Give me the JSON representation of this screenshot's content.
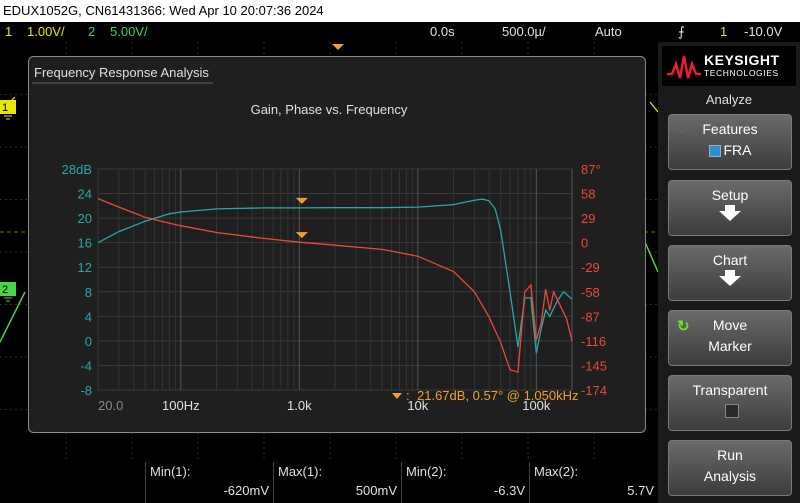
{
  "window": {
    "title": "EDUX1052G, CN61431366: Wed Apr 10 20:07:36 2024"
  },
  "status": {
    "ch1_num": "1",
    "ch1_scale": "1.00V/",
    "ch2_num": "2",
    "ch2_scale": "5.00V/",
    "time_pos": "0.0s",
    "time_scale": "500.0µ/",
    "trigger_mode": "Auto",
    "trig_src": "1",
    "trig_level": "-10.0V"
  },
  "fra": {
    "window_title": "Frequency Response Analysis",
    "plot_title": "Gain, Phase vs. Frequency",
    "marker_readout": "21.67dB, 0.57° @ 1.050kHz"
  },
  "chart_data": {
    "type": "line",
    "title": "Gain, Phase vs. Frequency",
    "x_scale": "log",
    "x_range_hz": [
      20,
      200000
    ],
    "x_tick_labels": [
      "20.0",
      "100Hz",
      "1.0k",
      "10k",
      "100k"
    ],
    "x_tick_values": [
      20,
      100,
      1000,
      10000,
      100000
    ],
    "y_left_range_db": [
      -8,
      28
    ],
    "y_left_tick_labels": [
      "28dB",
      "24",
      "20",
      "16",
      "12",
      "8",
      "4",
      "0",
      "-4",
      "-8"
    ],
    "y_right_range_deg": [
      -174,
      87
    ],
    "y_right_tick_labels": [
      "87°",
      "58",
      "29",
      "0",
      "-29",
      "-58",
      "-87",
      "-116",
      "-145",
      "-174"
    ],
    "grid": true,
    "series": [
      {
        "axis": "left",
        "color": "#2aa8a8",
        "x": [
          20,
          30,
          50,
          80,
          100,
          200,
          500,
          1000,
          2000,
          5000,
          10000,
          20000,
          30000,
          35000,
          40000,
          45000,
          50000,
          60000,
          70000,
          80000,
          90000,
          100000,
          110000,
          120000,
          130000,
          150000,
          170000,
          200000
        ],
        "y": [
          16,
          17.8,
          19.5,
          20.7,
          21,
          21.5,
          21.67,
          21.67,
          21.7,
          21.7,
          21.8,
          22.2,
          22.9,
          23.1,
          22.8,
          21.5,
          18,
          8,
          -1,
          7,
          7,
          -2,
          2,
          5,
          4,
          6.5,
          8,
          6.8
        ]
      },
      {
        "axis": "right",
        "color": "#e84a3c",
        "x": [
          20,
          30,
          50,
          80,
          100,
          200,
          500,
          1000,
          2000,
          5000,
          10000,
          20000,
          30000,
          40000,
          50000,
          60000,
          70000,
          80000,
          90000,
          100000,
          110000,
          120000,
          130000,
          140000,
          160000,
          180000,
          200000
        ],
        "y": [
          52,
          42,
          30,
          23,
          20,
          12,
          5,
          0.57,
          -3,
          -8,
          -16,
          -34,
          -58,
          -88,
          -118,
          -150,
          -153,
          -58,
          -50,
          -115,
          -95,
          -55,
          -80,
          -58,
          -75,
          -90,
          -116
        ]
      }
    ],
    "marker": {
      "x_hz": 1050,
      "gain_db": 21.67,
      "phase_deg": 0.57
    }
  },
  "side": {
    "brand": "KEYSIGHT",
    "brand_sub": "TECHNOLOGIES",
    "menu_title": "Analyze",
    "btn_features": "Features",
    "btn_features_value": "FRA",
    "btn_setup": "Setup",
    "btn_chart": "Chart",
    "btn_move": "Move",
    "btn_move_2": "Marker",
    "btn_transparent": "Transparent",
    "btn_run": "Run",
    "btn_run_2": "Analysis"
  },
  "measurements": [
    {
      "label": "Min(1):",
      "value": "-620mV"
    },
    {
      "label": "Max(1):",
      "value": "500mV"
    },
    {
      "label": "Min(2):",
      "value": "-6.3V"
    },
    {
      "label": "Max(2):",
      "value": "5.7V"
    }
  ]
}
